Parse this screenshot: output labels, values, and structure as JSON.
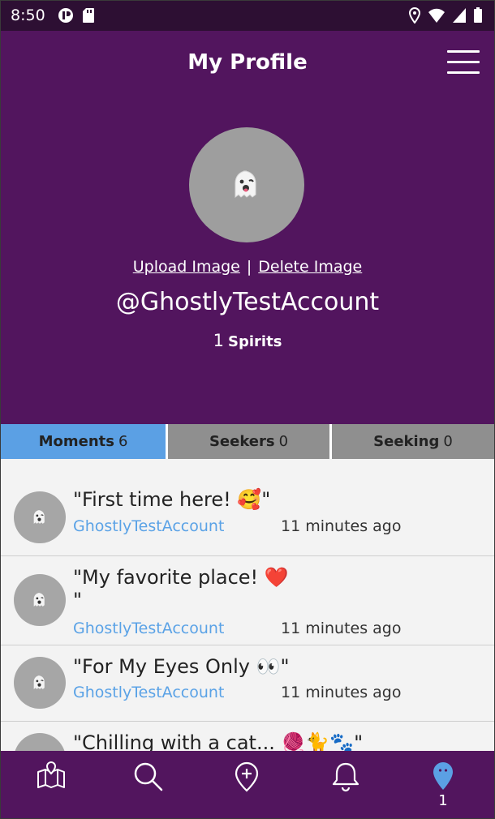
{
  "status_bar": {
    "time": "8:50"
  },
  "header": {
    "title": "My Profile",
    "upload_label": "Upload Image",
    "separator": "|",
    "delete_label": "Delete Image",
    "username": "@GhostlyTestAccount",
    "spirits_count": "1",
    "spirits_label": "Spirits"
  },
  "tabs": [
    {
      "label": "Moments",
      "count": "6",
      "active": true
    },
    {
      "label": "Seekers",
      "count": "0",
      "active": false
    },
    {
      "label": "Seeking",
      "count": "0",
      "active": false
    }
  ],
  "moments": [
    {
      "text": "\"First time here! 🥰\"",
      "author": "GhostlyTestAccount",
      "time": "11 minutes ago"
    },
    {
      "text": "\"My favorite place! ❤️",
      "text_line2": "\"",
      "author": "GhostlyTestAccount",
      "time": "11 minutes ago"
    },
    {
      "text": "\"For My Eyes Only 👀\"",
      "author": "GhostlyTestAccount",
      "time": "11 minutes ago"
    },
    {
      "text": "\"Chilling with a cat... 🧶🐈🐾\"",
      "author": "",
      "time": ""
    }
  ],
  "bottom_nav": {
    "items": [
      "map-icon",
      "search-icon",
      "add-location-icon",
      "bell-icon",
      "ghost-pin-icon"
    ],
    "badge": "1"
  },
  "colors": {
    "primary": "#52155e",
    "status_bar": "#2d0f33",
    "active_tab": "#5ba0e4",
    "inactive_tab": "#8f8f8f",
    "link": "#5aa2e6"
  }
}
